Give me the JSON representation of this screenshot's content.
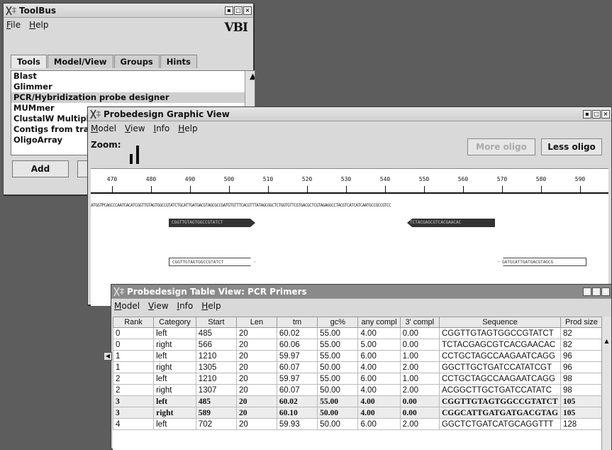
{
  "toolbus": {
    "title": "ToolBus",
    "menu": [
      "File",
      "Help"
    ],
    "logo": "VBI",
    "tabs": [
      "Tools",
      "Model/View",
      "Groups",
      "Hints"
    ],
    "tools": [
      "Blast",
      "Glimmer",
      "PCR/Hybridization probe designer",
      "MUMmer",
      "ClustalW Multipl",
      "Contigs from tra",
      "OligoArray"
    ],
    "selected_tool": "PCR/Hybridization probe designer",
    "add_label": "Add"
  },
  "graphic": {
    "title": "Probedesign Graphic View",
    "menu": [
      "Model",
      "View",
      "Info",
      "Help"
    ],
    "zoom_label": "Zoom:",
    "more_oligo": "More oligo",
    "less_oligo": "Less oligo",
    "ticks": [
      "470",
      "480",
      "490",
      "500",
      "510",
      "520",
      "530",
      "540",
      "550",
      "560",
      "570",
      "580",
      "590"
    ],
    "sequence": "ATGGTPCAGCCCAATCACATCGGTTGTAGTGGCCGTATCTGCATTGATGACGTAGCGCCGATGTGTTTCACGTTTATAGCGGCTCTGGTGTTCGTGACGCTCGTAGAGGCCTACGTCATCATCAATGCCGCCGTCC",
    "oligo1": "CGGTTGTAGTGGCCGTATCT",
    "oligo2": "TCTACGAGCGTCACGAACAC",
    "oligo3": "CGGTTGTAGTGGCCGTATCT",
    "oligo4": "GATGCATTGATGACGTAGCG"
  },
  "table": {
    "title": "Probedesign Table View: PCR Primers",
    "menu": [
      "Model",
      "View",
      "Info",
      "Help"
    ],
    "columns": [
      "Rank",
      "Category",
      "Start",
      "Len",
      "tm",
      "gc%",
      "any compl",
      "3' compl",
      "Sequence",
      "Prod size"
    ],
    "rows": [
      [
        "0",
        "left",
        "485",
        "20",
        "60.02",
        "55.00",
        "4.00",
        "0.00",
        "CGGTTGTAGTGGCCGTATCT",
        "82"
      ],
      [
        "0",
        "right",
        "566",
        "20",
        "60.06",
        "55.00",
        "5.00",
        "0.00",
        "TCTACGAGCGTCACGAACAC",
        "82"
      ],
      [
        "1",
        "left",
        "1210",
        "20",
        "59.97",
        "55.00",
        "6.00",
        "1.00",
        "CCTGCTAGCCAAGAATCAGG",
        "96"
      ],
      [
        "1",
        "right",
        "1305",
        "20",
        "60.07",
        "50.00",
        "4.00",
        "2.00",
        "GGCTTGCTGATCCATATCGT",
        "96"
      ],
      [
        "2",
        "left",
        "1210",
        "20",
        "59.97",
        "55.00",
        "6.00",
        "1.00",
        "CCTGCTAGCCAAGAATCAGG",
        "98"
      ],
      [
        "2",
        "right",
        "1307",
        "20",
        "60.07",
        "50.00",
        "4.00",
        "2.00",
        "ACGGCTTGCTGATCCATATC",
        "98"
      ],
      [
        "3",
        "left",
        "485",
        "20",
        "60.02",
        "55.00",
        "4.00",
        "0.00",
        "CGGTTGTAGTGGCCGTATCT",
        "105"
      ],
      [
        "3",
        "right",
        "589",
        "20",
        "60.10",
        "50.00",
        "4.00",
        "0.00",
        "CGGCATTGATGATGACGTAG",
        "105"
      ],
      [
        "4",
        "left",
        "702",
        "20",
        "59.93",
        "50.00",
        "6.00",
        "2.00",
        "GGCTCTGATCATGCAGGTTT",
        "128"
      ]
    ],
    "selected_rank": "3"
  }
}
